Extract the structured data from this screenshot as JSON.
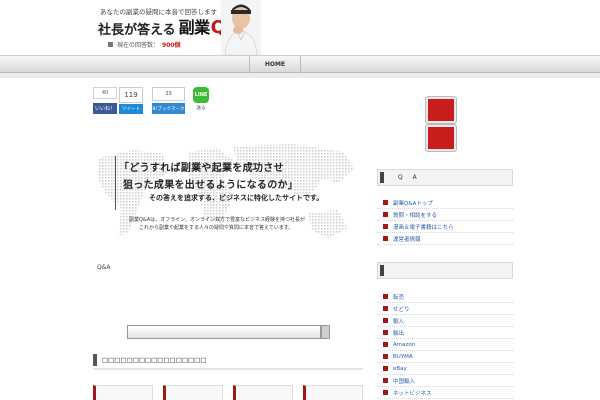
{
  "header": {
    "tagline": "あなたの副業の疑問に本音で回答します",
    "logo_pre": "社長が答える",
    "logo_main": "副業",
    "logo_qa": "Q&A",
    "count_label": "現在の回答数：",
    "count_value": "900個"
  },
  "nav": {
    "home": "HOME"
  },
  "share": {
    "fb_count": "40",
    "fb_label": "いいね！",
    "tw_count": "119",
    "tw_label": "ツイート",
    "hb_count": "23",
    "hb_label": "B!ブックマーク",
    "line_icon": "LINE",
    "line_label": "送る"
  },
  "hero": {
    "quote1": "「どうすれば副業や起業を成功させ",
    "quote2": "狙った成果を出せるようになるのか」",
    "quote3": "その答えを追求する、ビジネスに特化したサイトです。",
    "desc1": "副業Q&Aは、オフライン、オンライン双方で豊富なビジネス経験を持つ社長が",
    "desc2": "これから副業や起業をする人々の疑問や質問に本音で答えています。"
  },
  "main": {
    "qa_label": "Q&A",
    "section_title": "□□□□□□□□□□□□□□□□□"
  },
  "sidebar": {
    "widget1_title": "Q A",
    "menu1": [
      {
        "label": "副業Q&Aトップ"
      },
      {
        "label": "質問・相談をする"
      },
      {
        "label": "漫画＆電子書籍はこちら"
      },
      {
        "label": "運営者情報"
      }
    ],
    "widget2_title": "",
    "menu2": [
      {
        "label": "転売"
      },
      {
        "label": "せどり"
      },
      {
        "label": "輸入"
      },
      {
        "label": "輸出"
      },
      {
        "label": "Amazon"
      },
      {
        "label": "BUYMA"
      },
      {
        "label": "eBay"
      },
      {
        "label": "中国輸入"
      },
      {
        "label": "ネットビジネス"
      }
    ]
  },
  "colors": {
    "accent_red": "#c81919",
    "link_blue": "#2a5dab",
    "facebook": "#3b5998",
    "twitter": "#1d8bd8",
    "line": "#3dbb34"
  }
}
